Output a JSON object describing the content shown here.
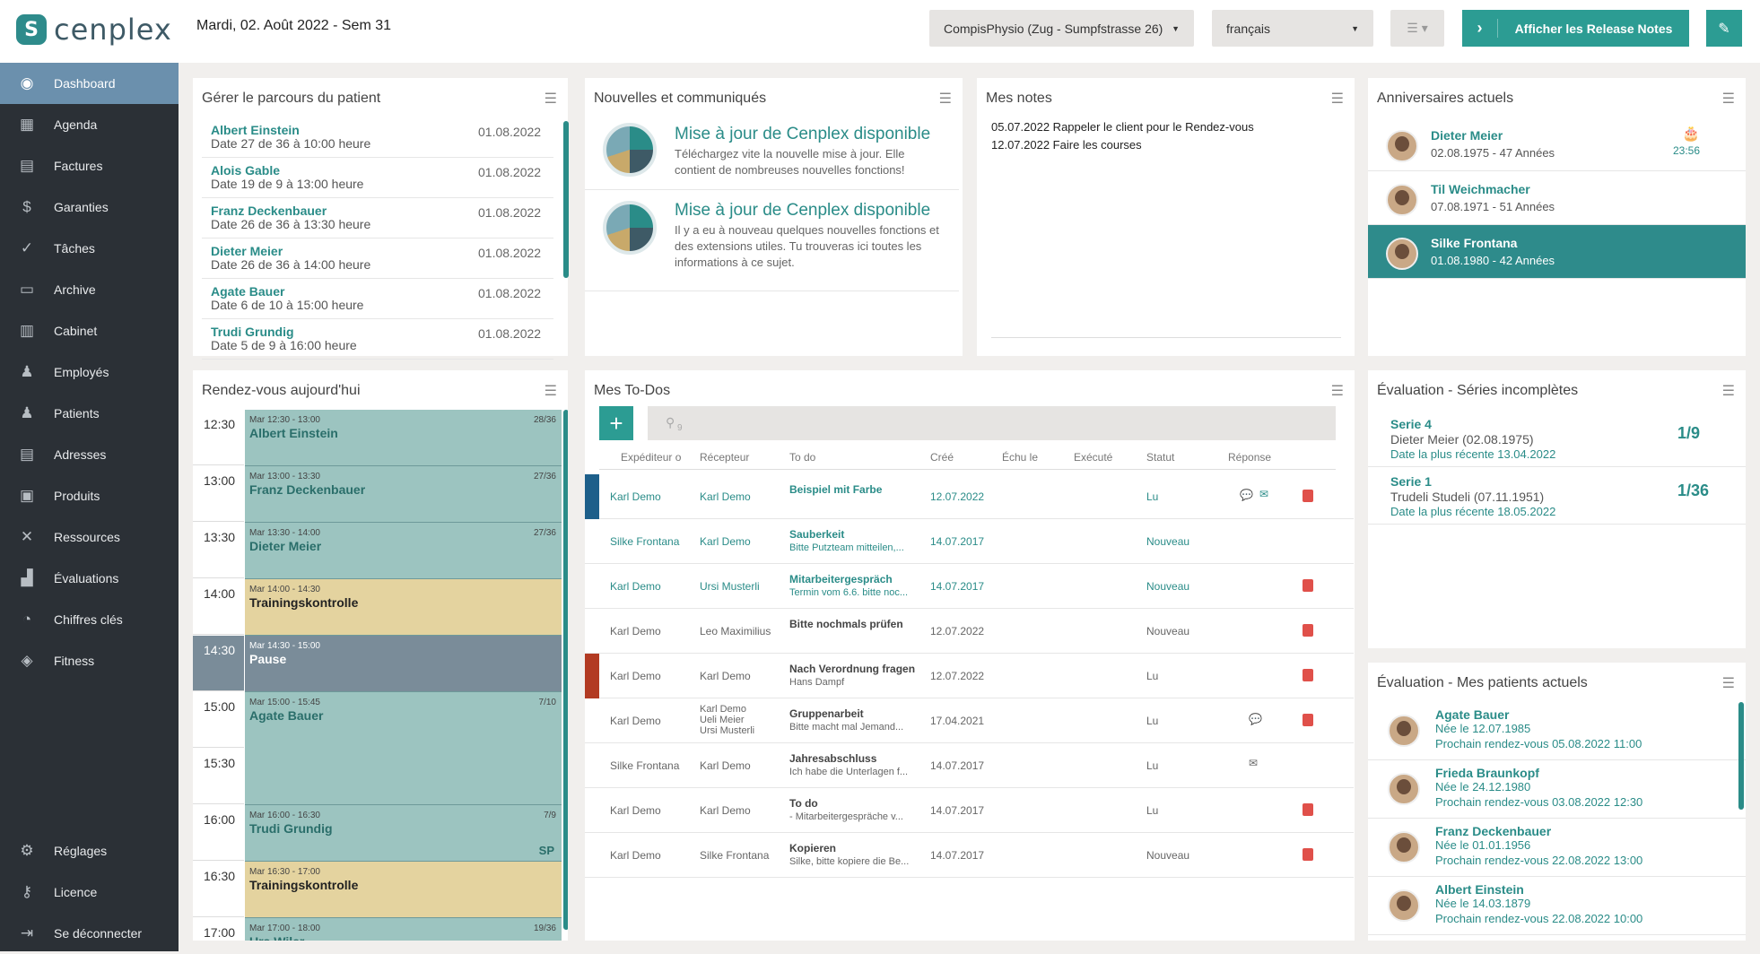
{
  "header": {
    "logo": "cenplex",
    "date": "Mardi, 02. Août 2022 - Sem 31",
    "practice": "CompisPhysio (Zug - Sumpfstrasse 26)",
    "language": "français",
    "release_label": "Afficher les Release Notes"
  },
  "sidebar": {
    "items": [
      {
        "label": "Dashboard",
        "icon": "dashboard-icon"
      },
      {
        "label": "Agenda",
        "icon": "calendar-icon"
      },
      {
        "label": "Factures",
        "icon": "invoice-icon"
      },
      {
        "label": "Garanties",
        "icon": "guarantee-icon"
      },
      {
        "label": "Tâches",
        "icon": "tasks-icon"
      },
      {
        "label": "Archive",
        "icon": "archive-icon"
      },
      {
        "label": "Cabinet",
        "icon": "building-icon"
      },
      {
        "label": "Employés",
        "icon": "employee-icon"
      },
      {
        "label": "Patients",
        "icon": "patients-icon"
      },
      {
        "label": "Adresses",
        "icon": "address-book-icon"
      },
      {
        "label": "Produits",
        "icon": "products-icon"
      },
      {
        "label": "Ressources",
        "icon": "tools-icon"
      },
      {
        "label": "Évaluations",
        "icon": "chart-icon"
      },
      {
        "label": "Chiffres clés",
        "icon": "gauge-icon"
      },
      {
        "label": "Fitness",
        "icon": "shield-icon"
      }
    ],
    "bottom": [
      {
        "label": "Réglages"
      },
      {
        "label": "Licence"
      },
      {
        "label": "Se déconnecter"
      }
    ]
  },
  "patient_path": {
    "title": "Gérer le parcours du patient",
    "rows": [
      {
        "name": "Albert Einstein",
        "detail": "Date 27 de 36 à 10:00 heure",
        "date": "01.08.2022"
      },
      {
        "name": "Alois Gable",
        "detail": "Date 19 de 9 à 13:00 heure",
        "date": "01.08.2022"
      },
      {
        "name": "Franz Deckenbauer",
        "detail": "Date 26 de 36 à 13:30 heure",
        "date": "01.08.2022"
      },
      {
        "name": "Dieter Meier",
        "detail": "Date 26 de 36 à 14:00 heure",
        "date": "01.08.2022"
      },
      {
        "name": "Agate Bauer",
        "detail": "Date 6 de 10 à 15:00 heure",
        "date": "01.08.2022"
      },
      {
        "name": "Trudi Grundig",
        "detail": "Date 5 de 9 à 16:00 heure",
        "date": "01.08.2022"
      }
    ]
  },
  "news": {
    "title": "Nouvelles et communiqués",
    "items": [
      {
        "title": "Mise à jour de Cenplex disponible",
        "body": "Téléchargez vite la nouvelle mise à jour. Elle contient de nombreuses nouvelles fonctions!"
      },
      {
        "title": "Mise à jour de Cenplex disponible",
        "body": "Il y a eu à nouveau quelques nouvelles fonctions et des extensions utiles. Tu trouveras ici toutes les informations à ce sujet."
      }
    ]
  },
  "notes": {
    "title": "Mes notes",
    "lines": [
      "05.07.2022 Rappeler le client pour  le Rendez-vous",
      "12.07.2022 Faire les courses"
    ]
  },
  "birthdays": {
    "title": "Anniversaires actuels",
    "cake_time": "23:56",
    "items": [
      {
        "name": "Dieter Meier",
        "detail": "02.08.1975 - 47 Années"
      },
      {
        "name": "Til Weichmacher",
        "detail": "07.08.1971 - 51 Années"
      },
      {
        "name": "Silke Frontana",
        "detail": "01.08.1980 - 42 Années"
      }
    ]
  },
  "agenda": {
    "title": "Rendez-vous aujourd'hui",
    "times": [
      "12:30",
      "13:00",
      "13:30",
      "14:00",
      "14:30",
      "15:00",
      "15:30",
      "16:00",
      "16:30",
      "17:00"
    ],
    "appts": [
      {
        "time": "Mar 12:30 - 13:00",
        "name": "Albert Einstein",
        "meta": "28/36"
      },
      {
        "time": "Mar 13:00 - 13:30",
        "name": "Franz Deckenbauer",
        "meta": "27/36"
      },
      {
        "time": "Mar 13:30 - 14:00",
        "name": "Dieter Meier",
        "meta": "27/36"
      },
      {
        "time": "Mar 14:00 - 14:30",
        "name": "Trainingskontrolle",
        "meta": ""
      },
      {
        "time": "Mar 14:30 - 15:00",
        "name": "Pause",
        "meta": ""
      },
      {
        "time": "Mar 15:00 - 15:45",
        "name": "Agate Bauer",
        "meta": "7/10"
      },
      {
        "time": "Mar 16:00 - 16:30",
        "name": "Trudi Grundig",
        "meta": "7/9",
        "tag": "SP"
      },
      {
        "time": "Mar 16:30 - 17:00",
        "name": "Trainingskontrolle",
        "meta": ""
      },
      {
        "time": "Mar 17:00 - 18:00",
        "name": "Urs Wiler",
        "meta": "19/36"
      }
    ]
  },
  "todos": {
    "title": "Mes To-Dos",
    "filter_count": "9",
    "headers": [
      "Expéditeur o",
      "Récepteur",
      "To do",
      "Créé",
      "Échu le",
      "Exécuté",
      "Statut",
      "Réponse"
    ],
    "rows": [
      {
        "from": "Karl Demo",
        "to": "Karl Demo",
        "title": "Beispiel mit Farbe",
        "sub": "",
        "created": "12.07.2022",
        "status": "Lu"
      },
      {
        "from": "Silke Frontana",
        "to": "Karl Demo",
        "title": "Sauberkeit",
        "sub": "Bitte Putzteam mitteilen,...",
        "created": "14.07.2017",
        "status": "Nouveau"
      },
      {
        "from": "Karl Demo",
        "to": "Ursi Musterli",
        "title": "Mitarbeitergespräch",
        "sub": "Termin vom 6.6. bitte noc...",
        "created": "14.07.2017",
        "status": "Nouveau"
      },
      {
        "from": "Karl Demo",
        "to": "Leo Maximilius",
        "title": "Bitte nochmals prüfen",
        "sub": "",
        "created": "12.07.2022",
        "status": "Nouveau"
      },
      {
        "from": "Karl Demo",
        "to": "Karl Demo",
        "title": "Nach Verordnung fragen",
        "sub": "Hans Dampf",
        "created": "12.07.2022",
        "status": "Lu"
      },
      {
        "from": "Karl Demo",
        "to": "Karl Demo",
        "to2": "Ueli  Meier",
        "to3": "Ursi Musterli",
        "title": "Gruppenarbeit",
        "sub": "Bitte macht mal Jemand...",
        "created": "17.04.2021",
        "status": "Lu"
      },
      {
        "from": "Silke Frontana",
        "to": "Karl Demo",
        "title": "Jahresabschluss",
        "sub": "Ich habe die Unterlagen f...",
        "created": "14.07.2017",
        "status": "Lu"
      },
      {
        "from": "Karl Demo",
        "to": "Karl Demo",
        "title": "To do",
        "sub": "- Mitarbeitergespräche v...",
        "created": "14.07.2017",
        "status": "Lu"
      },
      {
        "from": "Karl Demo",
        "to": "Silke Frontana",
        "title": "Kopieren",
        "sub": "Silke, bitte kopiere die Be...",
        "created": "14.07.2017",
        "status": "Nouveau"
      }
    ]
  },
  "series": {
    "title": "Évaluation - Séries incomplètes",
    "items": [
      {
        "name": "Serie 4",
        "who": "Dieter Meier (02.08.1975)",
        "recent": "Date la plus récente 13.04.2022",
        "ratio": "1/9"
      },
      {
        "name": "Serie 1",
        "who": "Trudeli Studeli (07.11.1951)",
        "recent": "Date la plus récente 18.05.2022",
        "ratio": "1/36"
      }
    ]
  },
  "current_patients": {
    "title": "Évaluation - Mes patients actuels",
    "items": [
      {
        "name": "Agate Bauer",
        "born": "Née le 12.07.1985",
        "next": "Prochain rendez-vous 05.08.2022 11:00"
      },
      {
        "name": "Frieda Braunkopf",
        "born": "Née le 24.12.1980",
        "next": "Prochain rendez-vous 03.08.2022 12:30"
      },
      {
        "name": "Franz Deckenbauer",
        "born": "Née le 01.01.1956",
        "next": "Prochain rendez-vous 22.08.2022 13:00"
      },
      {
        "name": "Albert Einstein",
        "born": "Née le 14.03.1879",
        "next": "Prochain rendez-vous 22.08.2022 10:00"
      }
    ]
  }
}
